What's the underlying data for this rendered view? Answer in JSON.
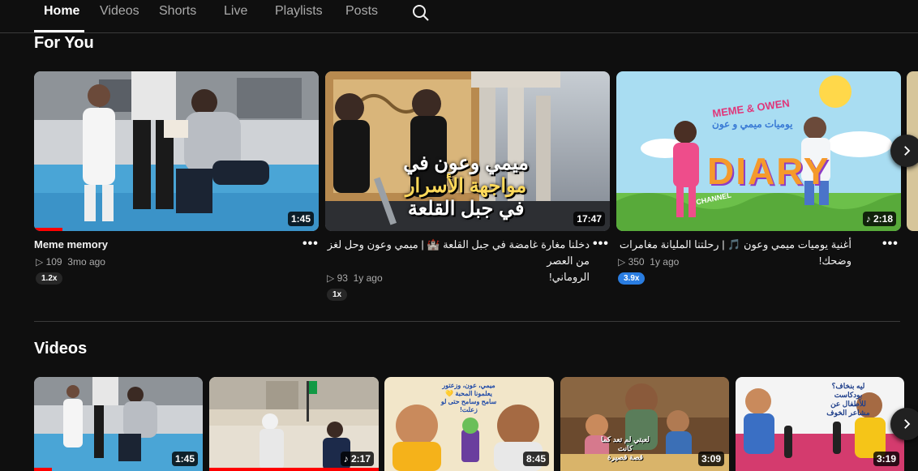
{
  "tabs": {
    "items": [
      "Home",
      "Videos",
      "Shorts",
      "Live",
      "Playlists",
      "Posts"
    ],
    "active": "Home"
  },
  "sections": {
    "for_you": {
      "title": "For You",
      "videos": [
        {
          "title": "Meme memory",
          "views": "109",
          "age": "3mo ago",
          "duration": "1:45",
          "speed": "1.2x"
        },
        {
          "title_line1": "دخلنا مغارة غامضة في جبل القلعة 🏰 | ميمي وعون وحل لغز من العصر",
          "title_line2": "الروماني!",
          "views": "93",
          "age": "1y ago",
          "duration": "17:47",
          "speed": "1x",
          "overlay_text": [
            "ميمي وعون في",
            "مواجهة الأسرار",
            "في جبل القلعة"
          ]
        },
        {
          "title": "أغنية يوميات ميمي وعون 🎵 | رحلتنا المليانة مغامرات وضحك!",
          "views": "350",
          "age": "1y ago",
          "duration": "2:18",
          "speed": "3.9x",
          "overlay_brand": "MEME & OWEN",
          "overlay_arabic": "يوميات ميمي و عون",
          "overlay_diary": "DIARY",
          "overlay_channel": "CHANNEL"
        }
      ]
    },
    "videos": {
      "title": "Videos",
      "items": [
        {
          "duration": "1:45"
        },
        {
          "duration": "2:17"
        },
        {
          "duration": "8:45",
          "overlay_text": [
            "ميمي، عون، وزعتور",
            "يعلمونا المحبة 💛",
            "سامح وسامح حتى لو",
            "زعلت!"
          ]
        },
        {
          "duration": "3:09",
          "overlay_text": [
            "لعبتي لم تعد كما كانت",
            "قصة قصيرة"
          ]
        },
        {
          "duration": "3:19",
          "overlay_text": [
            "ليه بنخاف؟",
            "بودكاست",
            "للأطفال عن",
            "مشاعر الخوف"
          ]
        }
      ]
    }
  },
  "colors": {
    "background": "#0f0f0f",
    "accent": "#ff0000",
    "speed_blue": "#2a7de1"
  },
  "icons": {
    "search": "search-icon",
    "next": "chevron-right-icon",
    "more": "more-dots-icon",
    "play": "play-icon",
    "music": "music-note-icon"
  }
}
